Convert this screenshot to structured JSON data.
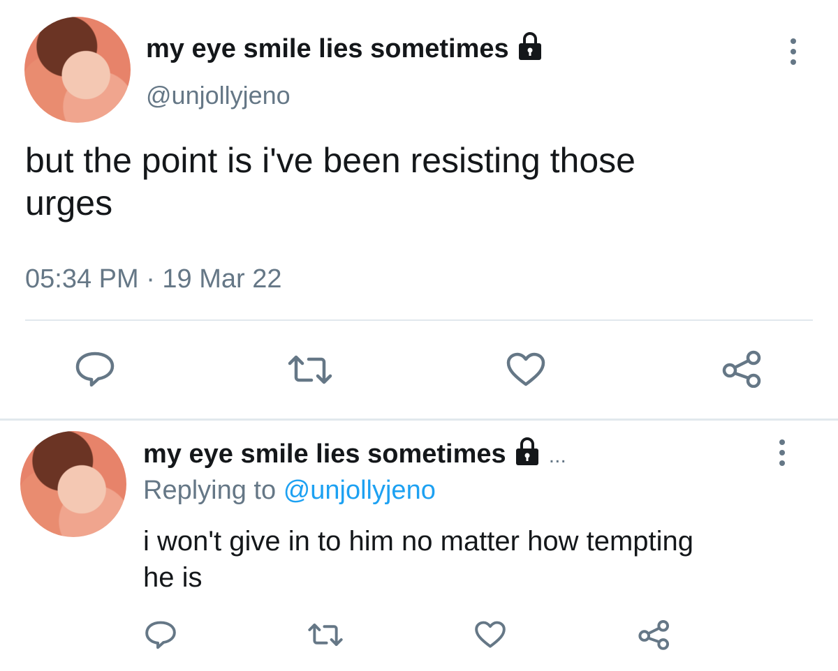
{
  "main_tweet": {
    "display_name": "my eye smile lies sometimes",
    "handle": "@unjollyjeno",
    "text_line1": "but the point is i've been resisting those",
    "text_line2": "urges",
    "timestamp": "05:34 PM · 19 Mar 22",
    "protected_icon": "lock-icon",
    "menu_icon": "more-vertical-icon"
  },
  "actions": {
    "reply_icon": "reply-icon",
    "retweet_icon": "retweet-icon",
    "like_icon": "heart-icon",
    "share_icon": "share-icon"
  },
  "reply_tweet": {
    "display_name": "my eye smile lies sometimes",
    "ellipsis": "...",
    "replying_to_label": "Replying to",
    "replying_to_handle": "@unjollyjeno",
    "text_line1": "i won't give in to him no matter how tempting",
    "text_line2": "he is"
  },
  "colors": {
    "text": "#14171a",
    "secondary": "#657786",
    "link": "#1da1f2",
    "separator": "#e1e8ed"
  }
}
